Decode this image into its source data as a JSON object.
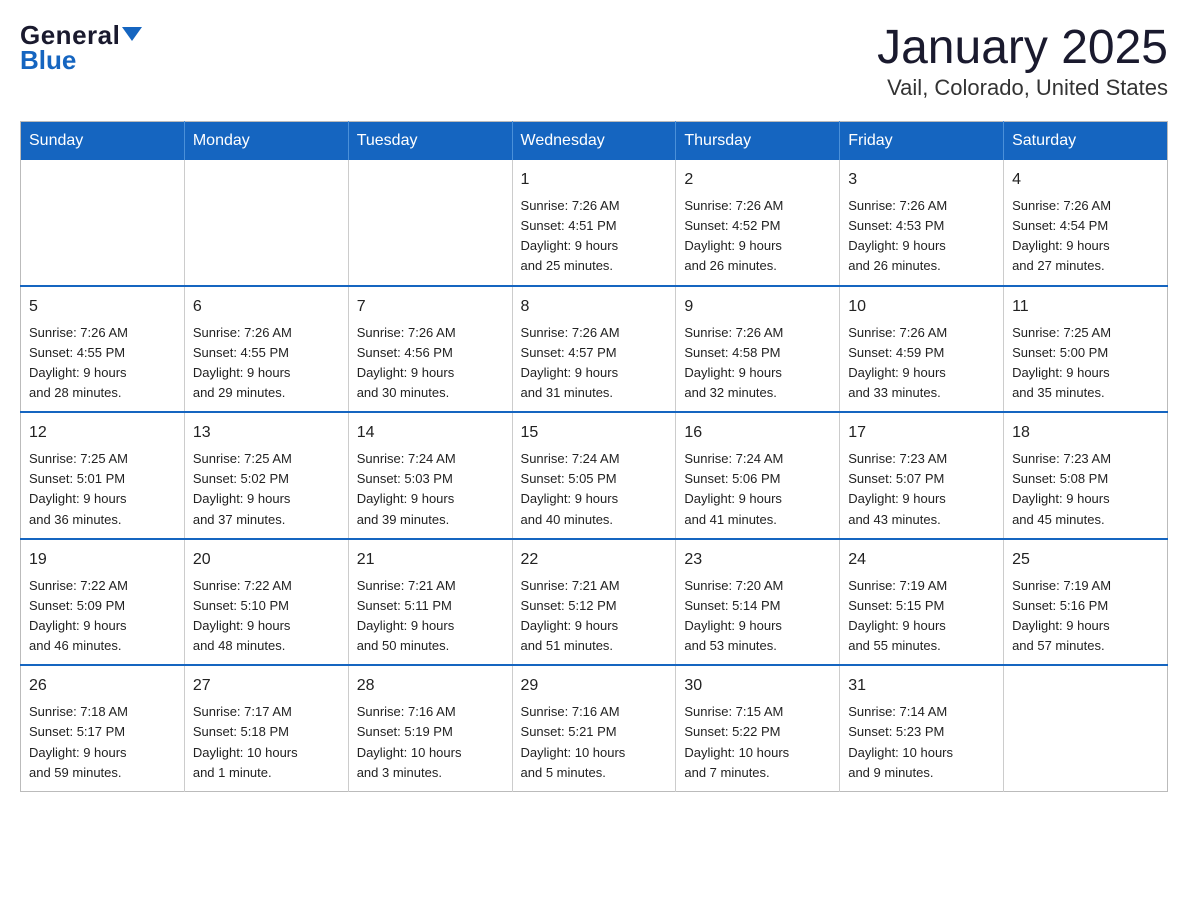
{
  "header": {
    "logo_general": "General",
    "logo_blue": "Blue",
    "title": "January 2025",
    "subtitle": "Vail, Colorado, United States"
  },
  "days_of_week": [
    "Sunday",
    "Monday",
    "Tuesday",
    "Wednesday",
    "Thursday",
    "Friday",
    "Saturday"
  ],
  "weeks": [
    [
      {
        "day": "",
        "info": ""
      },
      {
        "day": "",
        "info": ""
      },
      {
        "day": "",
        "info": ""
      },
      {
        "day": "1",
        "info": "Sunrise: 7:26 AM\nSunset: 4:51 PM\nDaylight: 9 hours\nand 25 minutes."
      },
      {
        "day": "2",
        "info": "Sunrise: 7:26 AM\nSunset: 4:52 PM\nDaylight: 9 hours\nand 26 minutes."
      },
      {
        "day": "3",
        "info": "Sunrise: 7:26 AM\nSunset: 4:53 PM\nDaylight: 9 hours\nand 26 minutes."
      },
      {
        "day": "4",
        "info": "Sunrise: 7:26 AM\nSunset: 4:54 PM\nDaylight: 9 hours\nand 27 minutes."
      }
    ],
    [
      {
        "day": "5",
        "info": "Sunrise: 7:26 AM\nSunset: 4:55 PM\nDaylight: 9 hours\nand 28 minutes."
      },
      {
        "day": "6",
        "info": "Sunrise: 7:26 AM\nSunset: 4:55 PM\nDaylight: 9 hours\nand 29 minutes."
      },
      {
        "day": "7",
        "info": "Sunrise: 7:26 AM\nSunset: 4:56 PM\nDaylight: 9 hours\nand 30 minutes."
      },
      {
        "day": "8",
        "info": "Sunrise: 7:26 AM\nSunset: 4:57 PM\nDaylight: 9 hours\nand 31 minutes."
      },
      {
        "day": "9",
        "info": "Sunrise: 7:26 AM\nSunset: 4:58 PM\nDaylight: 9 hours\nand 32 minutes."
      },
      {
        "day": "10",
        "info": "Sunrise: 7:26 AM\nSunset: 4:59 PM\nDaylight: 9 hours\nand 33 minutes."
      },
      {
        "day": "11",
        "info": "Sunrise: 7:25 AM\nSunset: 5:00 PM\nDaylight: 9 hours\nand 35 minutes."
      }
    ],
    [
      {
        "day": "12",
        "info": "Sunrise: 7:25 AM\nSunset: 5:01 PM\nDaylight: 9 hours\nand 36 minutes."
      },
      {
        "day": "13",
        "info": "Sunrise: 7:25 AM\nSunset: 5:02 PM\nDaylight: 9 hours\nand 37 minutes."
      },
      {
        "day": "14",
        "info": "Sunrise: 7:24 AM\nSunset: 5:03 PM\nDaylight: 9 hours\nand 39 minutes."
      },
      {
        "day": "15",
        "info": "Sunrise: 7:24 AM\nSunset: 5:05 PM\nDaylight: 9 hours\nand 40 minutes."
      },
      {
        "day": "16",
        "info": "Sunrise: 7:24 AM\nSunset: 5:06 PM\nDaylight: 9 hours\nand 41 minutes."
      },
      {
        "day": "17",
        "info": "Sunrise: 7:23 AM\nSunset: 5:07 PM\nDaylight: 9 hours\nand 43 minutes."
      },
      {
        "day": "18",
        "info": "Sunrise: 7:23 AM\nSunset: 5:08 PM\nDaylight: 9 hours\nand 45 minutes."
      }
    ],
    [
      {
        "day": "19",
        "info": "Sunrise: 7:22 AM\nSunset: 5:09 PM\nDaylight: 9 hours\nand 46 minutes."
      },
      {
        "day": "20",
        "info": "Sunrise: 7:22 AM\nSunset: 5:10 PM\nDaylight: 9 hours\nand 48 minutes."
      },
      {
        "day": "21",
        "info": "Sunrise: 7:21 AM\nSunset: 5:11 PM\nDaylight: 9 hours\nand 50 minutes."
      },
      {
        "day": "22",
        "info": "Sunrise: 7:21 AM\nSunset: 5:12 PM\nDaylight: 9 hours\nand 51 minutes."
      },
      {
        "day": "23",
        "info": "Sunrise: 7:20 AM\nSunset: 5:14 PM\nDaylight: 9 hours\nand 53 minutes."
      },
      {
        "day": "24",
        "info": "Sunrise: 7:19 AM\nSunset: 5:15 PM\nDaylight: 9 hours\nand 55 minutes."
      },
      {
        "day": "25",
        "info": "Sunrise: 7:19 AM\nSunset: 5:16 PM\nDaylight: 9 hours\nand 57 minutes."
      }
    ],
    [
      {
        "day": "26",
        "info": "Sunrise: 7:18 AM\nSunset: 5:17 PM\nDaylight: 9 hours\nand 59 minutes."
      },
      {
        "day": "27",
        "info": "Sunrise: 7:17 AM\nSunset: 5:18 PM\nDaylight: 10 hours\nand 1 minute."
      },
      {
        "day": "28",
        "info": "Sunrise: 7:16 AM\nSunset: 5:19 PM\nDaylight: 10 hours\nand 3 minutes."
      },
      {
        "day": "29",
        "info": "Sunrise: 7:16 AM\nSunset: 5:21 PM\nDaylight: 10 hours\nand 5 minutes."
      },
      {
        "day": "30",
        "info": "Sunrise: 7:15 AM\nSunset: 5:22 PM\nDaylight: 10 hours\nand 7 minutes."
      },
      {
        "day": "31",
        "info": "Sunrise: 7:14 AM\nSunset: 5:23 PM\nDaylight: 10 hours\nand 9 minutes."
      },
      {
        "day": "",
        "info": ""
      }
    ]
  ]
}
